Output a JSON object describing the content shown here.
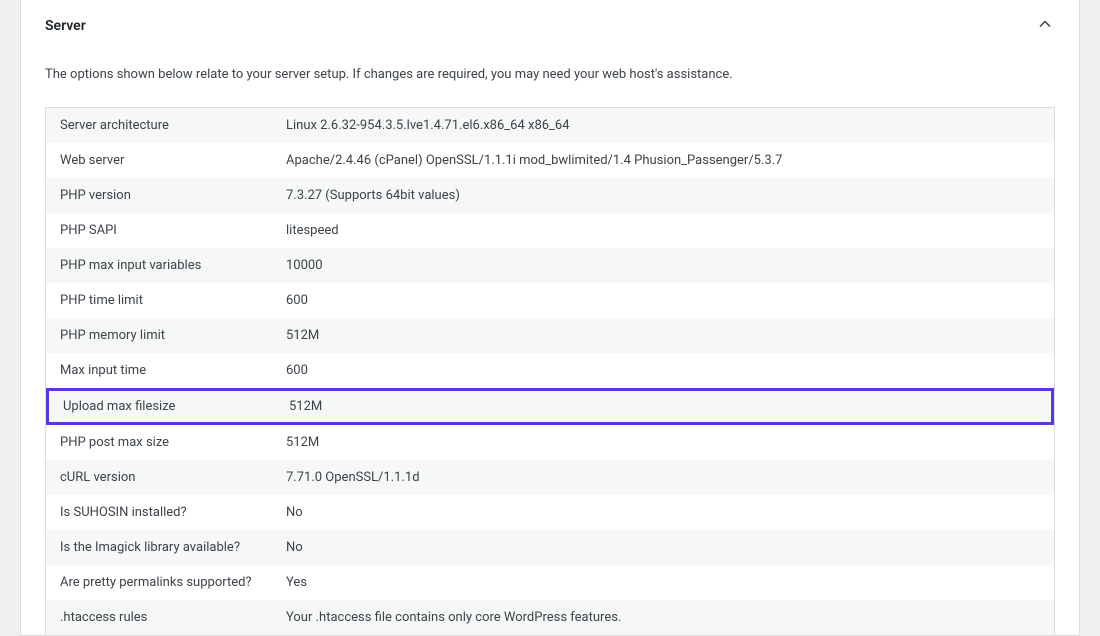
{
  "section": {
    "title": "Server",
    "description": "The options shown below relate to your server setup. If changes are required, you may need your web host's assistance."
  },
  "rows": [
    {
      "label": "Server architecture",
      "value": "Linux 2.6.32-954.3.5.lve1.4.71.el6.x86_64 x86_64"
    },
    {
      "label": "Web server",
      "value": "Apache/2.4.46 (cPanel) OpenSSL/1.1.1i mod_bwlimited/1.4 Phusion_Passenger/5.3.7"
    },
    {
      "label": "PHP version",
      "value": "7.3.27 (Supports 64bit values)"
    },
    {
      "label": "PHP SAPI",
      "value": "litespeed"
    },
    {
      "label": "PHP max input variables",
      "value": "10000"
    },
    {
      "label": "PHP time limit",
      "value": "600"
    },
    {
      "label": "PHP memory limit",
      "value": "512M"
    },
    {
      "label": "Max input time",
      "value": "600"
    },
    {
      "label": "Upload max filesize",
      "value": "512M",
      "highlighted": true
    },
    {
      "label": "PHP post max size",
      "value": "512M"
    },
    {
      "label": "cURL version",
      "value": "7.71.0 OpenSSL/1.1.1d"
    },
    {
      "label": "Is SUHOSIN installed?",
      "value": "No"
    },
    {
      "label": "Is the Imagick library available?",
      "value": "No"
    },
    {
      "label": "Are pretty permalinks supported?",
      "value": "Yes"
    },
    {
      "label": ".htaccess rules",
      "value": "Your .htaccess file contains only core WordPress features."
    }
  ]
}
